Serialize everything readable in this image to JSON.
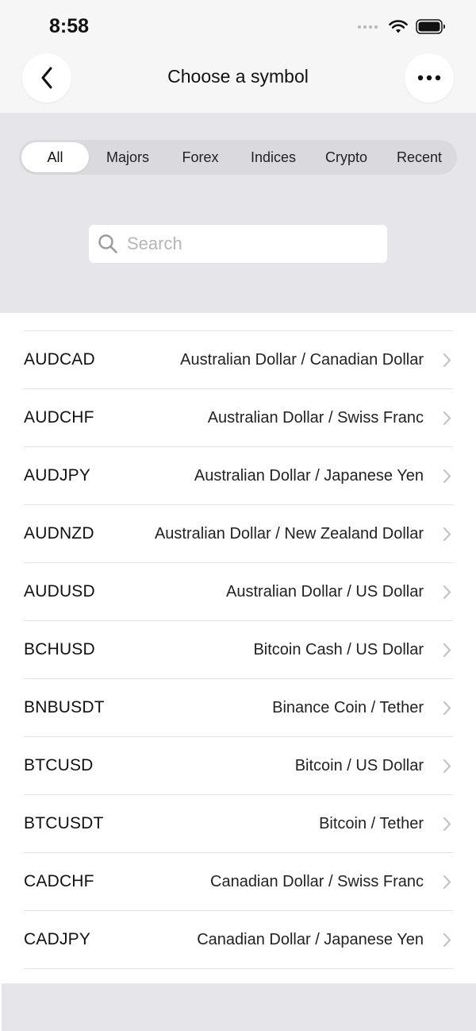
{
  "status_bar": {
    "time": "8:58"
  },
  "header": {
    "title": "Choose a symbol"
  },
  "tabs": [
    {
      "label": "All",
      "active": true
    },
    {
      "label": "Majors",
      "active": false
    },
    {
      "label": "Forex",
      "active": false
    },
    {
      "label": "Indices",
      "active": false
    },
    {
      "label": "Crypto",
      "active": false
    },
    {
      "label": "Recent",
      "active": false
    }
  ],
  "search": {
    "placeholder": "Search",
    "value": ""
  },
  "symbols": [
    {
      "code": "AUDCAD",
      "name": "Australian Dollar / Canadian Dollar"
    },
    {
      "code": "AUDCHF",
      "name": "Australian Dollar / Swiss Franc"
    },
    {
      "code": "AUDJPY",
      "name": "Australian Dollar / Japanese Yen"
    },
    {
      "code": "AUDNZD",
      "name": "Australian Dollar / New Zealand Dollar"
    },
    {
      "code": "AUDUSD",
      "name": "Australian Dollar / US Dollar"
    },
    {
      "code": "BCHUSD",
      "name": "Bitcoin Cash / US Dollar"
    },
    {
      "code": "BNBUSDT",
      "name": "Binance Coin / Tether"
    },
    {
      "code": "BTCUSD",
      "name": "Bitcoin / US Dollar"
    },
    {
      "code": "BTCUSDT",
      "name": "Bitcoin / Tether"
    },
    {
      "code": "CADCHF",
      "name": "Canadian Dollar / Swiss Franc"
    },
    {
      "code": "CADJPY",
      "name": "Canadian Dollar / Japanese Yen"
    }
  ],
  "icons": {
    "back": "chevron-left-icon",
    "more": "more-horizontal-icon",
    "search": "search-icon",
    "row": "chevron-right-icon",
    "signal": "signal-icon",
    "wifi": "wifi-icon",
    "battery": "battery-icon"
  },
  "colors": {
    "page_bg": "#ffffff",
    "filter_bg": "#e5e5ea",
    "tab_track": "#d9d9de",
    "divider": "#e2e2e2",
    "placeholder": "#b5b5ba",
    "chevron": "#c4c4c7"
  }
}
